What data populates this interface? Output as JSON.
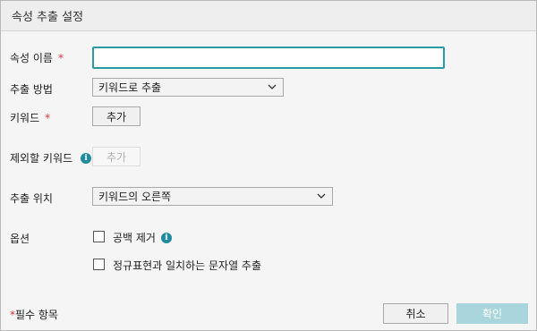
{
  "dialog": {
    "title": "속성 추출 설정"
  },
  "fields": {
    "attr_name_label": "속성 이름",
    "attr_name_required": "*",
    "attr_name_value": "",
    "method_label": "추출 방법",
    "method_value": "키워드로 추출",
    "keyword_label": "키워드",
    "keyword_required": "*",
    "keyword_add": "추가",
    "exclude_label": "제외할 키워드",
    "exclude_add": "추가",
    "position_label": "추출 위치",
    "position_value": "키워드의 오른쪽",
    "options_label": "옵션",
    "option_trim": "공백 제거",
    "option_regex": "정규표현과 일치하는 문자열 추출"
  },
  "footer": {
    "required_star": "*",
    "required_note": "필수 항목",
    "cancel": "취소",
    "confirm": "확인"
  },
  "icons": {
    "info": "info-icon",
    "chevron": "chevron-down-icon"
  },
  "colors": {
    "accent": "#2a9aa4",
    "info": "#1f8aa0",
    "required": "#d9363e",
    "confirm_disabled": "#a8d6dc"
  }
}
